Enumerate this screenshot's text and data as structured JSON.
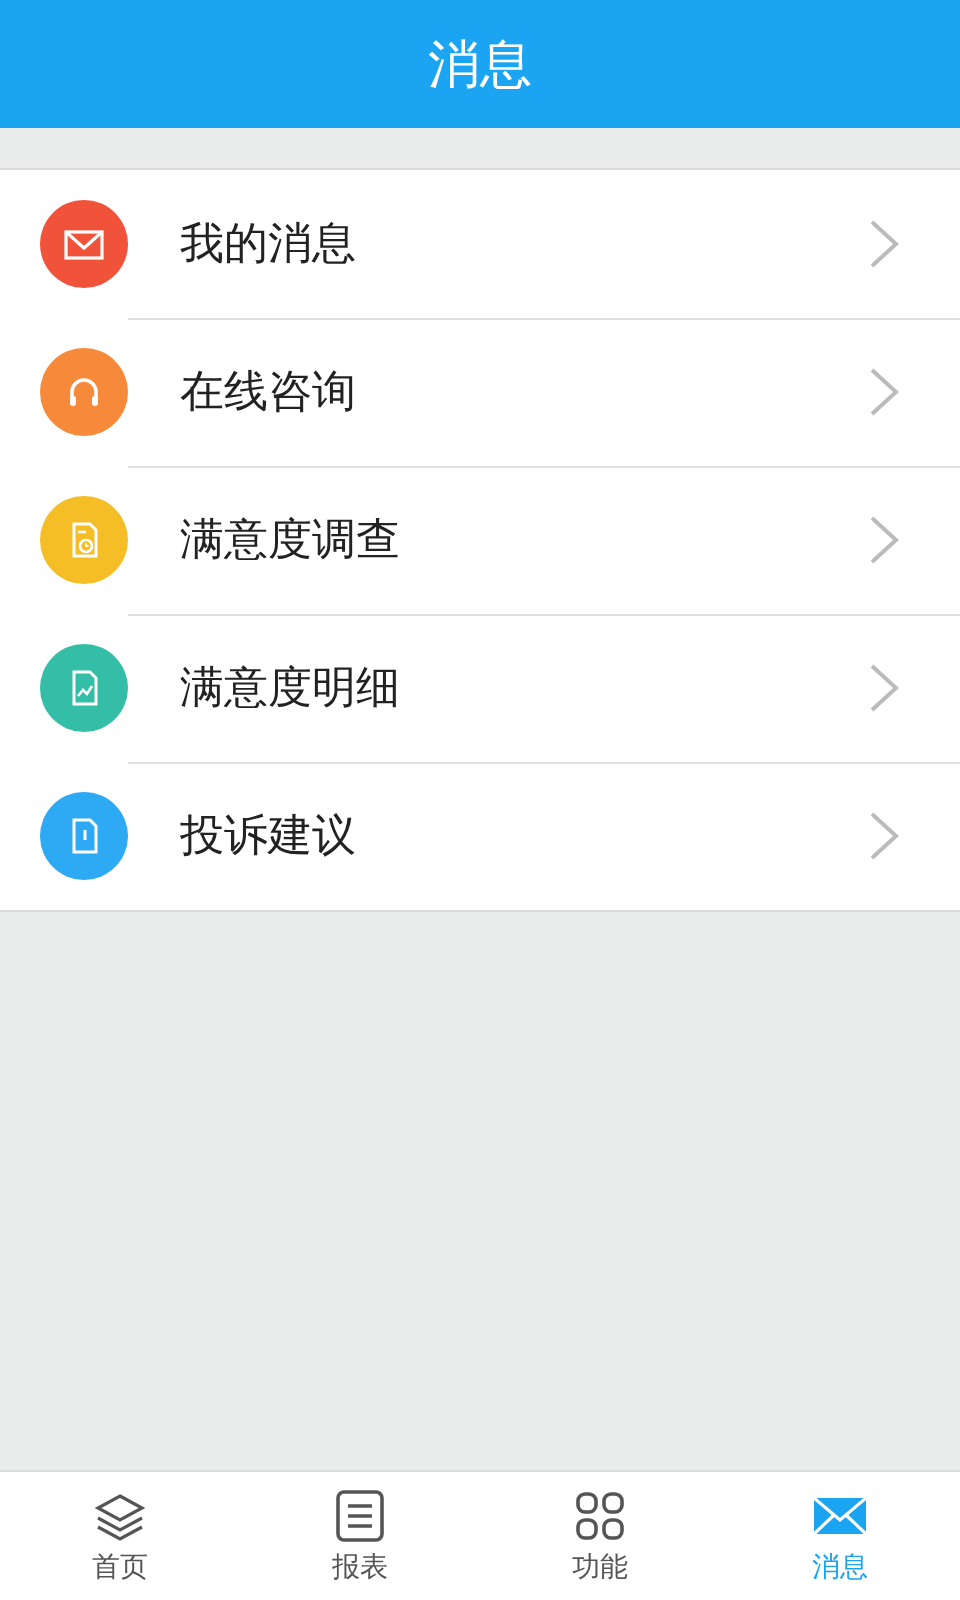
{
  "header": {
    "title": "消息"
  },
  "items": [
    {
      "label": "我的消息",
      "kind": "mail",
      "color": "#f0523a"
    },
    {
      "label": "在线咨询",
      "kind": "headset",
      "color": "#f68a3a"
    },
    {
      "label": "满意度调查",
      "kind": "survey",
      "color": "#f5bd26"
    },
    {
      "label": "满意度明细",
      "kind": "chart",
      "color": "#34bea7"
    },
    {
      "label": "投诉建议",
      "kind": "notice",
      "color": "#2ea9f3"
    }
  ],
  "tabs": [
    {
      "label": "首页",
      "kind": "layers",
      "selected": false
    },
    {
      "label": "报表",
      "kind": "list",
      "selected": false
    },
    {
      "label": "功能",
      "kind": "grid",
      "selected": false
    },
    {
      "label": "消息",
      "kind": "mail",
      "selected": true
    }
  ]
}
